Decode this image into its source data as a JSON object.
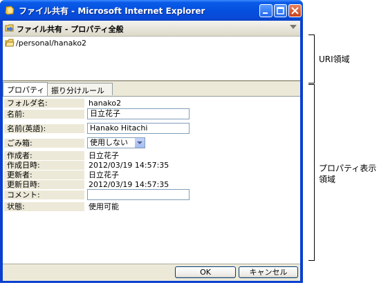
{
  "window": {
    "title": "ファイル共有 - Microsoft Internet Explorer"
  },
  "panel": {
    "title": "ファイル共有 - プロパティ全般",
    "uri": "/personal/hanako2"
  },
  "tabs": [
    {
      "label": "プロパティ",
      "active": true
    },
    {
      "label": "振り分けルール",
      "active": false
    }
  ],
  "properties": [
    {
      "label": "フォルダ名:",
      "value": "hanako2",
      "kind": "text"
    },
    {
      "label": "名前:",
      "value": "日立花子",
      "kind": "input"
    },
    {
      "label": "名前(英語):",
      "value": "Hanako Hitachi",
      "kind": "input"
    },
    {
      "label": "ごみ箱:",
      "value": "使用しない",
      "kind": "select"
    },
    {
      "label": "作成者:",
      "value": "日立花子",
      "kind": "text"
    },
    {
      "label": "作成日時:",
      "value": "2012/03/19 14:57:35",
      "kind": "text"
    },
    {
      "label": "更新者:",
      "value": "日立花子",
      "kind": "text"
    },
    {
      "label": "更新日時:",
      "value": "2012/03/19 14:57:35",
      "kind": "text"
    },
    {
      "label": "コメント:",
      "value": "",
      "kind": "input"
    },
    {
      "label": "状態:",
      "value": "使用可能",
      "kind": "text"
    }
  ],
  "buttons": {
    "ok": "OK",
    "cancel": "キャンセル"
  },
  "annotations": {
    "uri_area": "URI領域",
    "property_area_line1": "プロパティ表示",
    "property_area_line2": "領域"
  },
  "icons": {
    "title": "ie-icon",
    "panel": "folder-share-icon",
    "uri": "folder-icon"
  },
  "colors": {
    "titlebar": "#0550df",
    "window_bg": "#ece9d8",
    "label_bg": "#ece9d8",
    "input_border": "#7f9db9"
  }
}
